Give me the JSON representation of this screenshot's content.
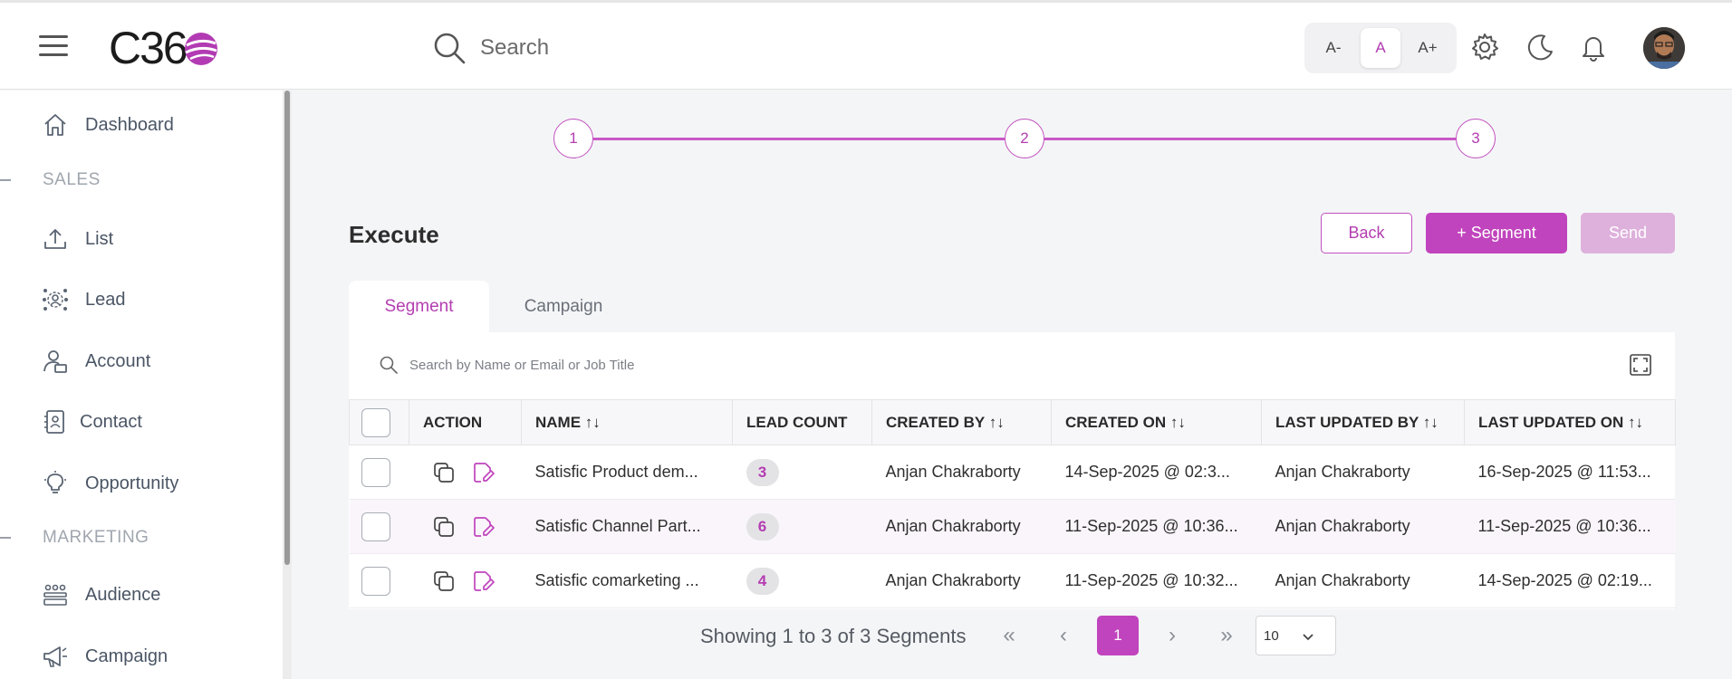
{
  "header": {
    "logo_text": "C36",
    "search_placeholder": "Search",
    "font_sizes": [
      "A-",
      "A",
      "A+"
    ],
    "active_font_size": "A"
  },
  "sidebar": {
    "items": [
      {
        "label": "Dashboard",
        "icon": "home-icon"
      },
      {
        "section": "SALES"
      },
      {
        "label": "List",
        "icon": "upload-icon"
      },
      {
        "label": "Lead",
        "icon": "lead-network-icon"
      },
      {
        "label": "Account",
        "icon": "account-icon"
      },
      {
        "label": "Contact",
        "icon": "contact-card-icon"
      },
      {
        "label": "Opportunity",
        "icon": "lightbulb-icon"
      },
      {
        "section": "MARKETING"
      },
      {
        "label": "Audience",
        "icon": "audience-icon"
      },
      {
        "label": "Campaign",
        "icon": "megaphone-icon"
      }
    ]
  },
  "stepper": {
    "steps": [
      "1",
      "2",
      "3"
    ]
  },
  "page": {
    "title": "Execute",
    "buttons": {
      "back": "Back",
      "segment": "+ Segment",
      "send": "Send"
    },
    "tabs": [
      "Segment",
      "Campaign"
    ],
    "active_tab": "Segment",
    "table_search_placeholder": "Search by Name or Email or Job Title"
  },
  "table": {
    "columns": [
      "ACTION",
      "NAME",
      "LEAD COUNT",
      "CREATED BY",
      "CREATED ON",
      "LAST UPDATED BY",
      "LAST UPDATED ON"
    ],
    "sortable_glyph": "↑↓",
    "rows": [
      {
        "name": "Satisfic Product dem...",
        "lead_count": "3",
        "created_by": "Anjan Chakraborty",
        "created_on": "14-Sep-2025 @ 02:3...",
        "last_updated_by": "Anjan Chakraborty",
        "last_updated_on": "16-Sep-2025 @ 11:53..."
      },
      {
        "name": "Satisfic Channel Part...",
        "lead_count": "6",
        "created_by": "Anjan Chakraborty",
        "created_on": "11-Sep-2025 @ 10:36...",
        "last_updated_by": "Anjan Chakraborty",
        "last_updated_on": "11-Sep-2025 @ 10:36..."
      },
      {
        "name": "Satisfic comarketing ...",
        "lead_count": "4",
        "created_by": "Anjan Chakraborty",
        "created_on": "11-Sep-2025 @ 10:32...",
        "last_updated_by": "Anjan Chakraborty",
        "last_updated_on": "14-Sep-2025 @ 02:19..."
      }
    ]
  },
  "pagination": {
    "summary": "Showing 1 to 3 of 3 Segments",
    "current_page": "1",
    "page_size": "10",
    "nav": {
      "first": "«",
      "prev": "‹",
      "next": "›",
      "last": "»"
    }
  },
  "colors": {
    "accent": "#C044BD",
    "accent_light": "#DEB1DD"
  }
}
